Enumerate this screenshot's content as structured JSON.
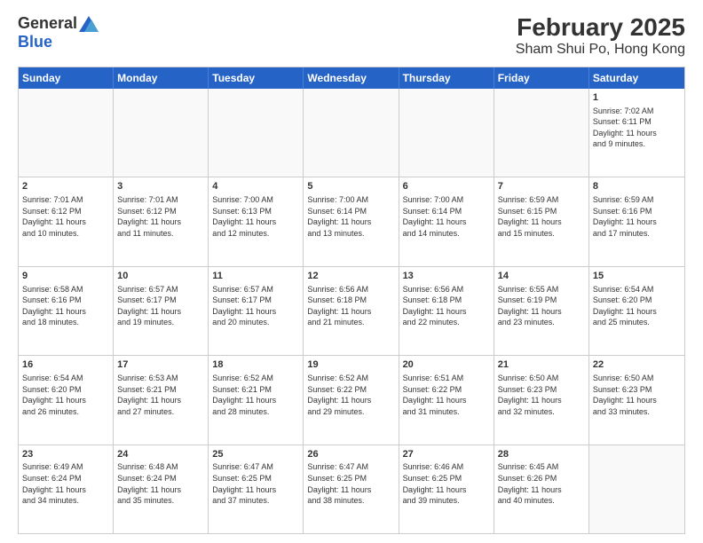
{
  "logo": {
    "general": "General",
    "blue": "Blue"
  },
  "title": {
    "month": "February 2025",
    "location": "Sham Shui Po, Hong Kong"
  },
  "weekdays": [
    "Sunday",
    "Monday",
    "Tuesday",
    "Wednesday",
    "Thursday",
    "Friday",
    "Saturday"
  ],
  "rows": [
    [
      {
        "day": "",
        "info": ""
      },
      {
        "day": "",
        "info": ""
      },
      {
        "day": "",
        "info": ""
      },
      {
        "day": "",
        "info": ""
      },
      {
        "day": "",
        "info": ""
      },
      {
        "day": "",
        "info": ""
      },
      {
        "day": "1",
        "info": "Sunrise: 7:02 AM\nSunset: 6:11 PM\nDaylight: 11 hours\nand 9 minutes."
      }
    ],
    [
      {
        "day": "2",
        "info": "Sunrise: 7:01 AM\nSunset: 6:12 PM\nDaylight: 11 hours\nand 10 minutes."
      },
      {
        "day": "3",
        "info": "Sunrise: 7:01 AM\nSunset: 6:12 PM\nDaylight: 11 hours\nand 11 minutes."
      },
      {
        "day": "4",
        "info": "Sunrise: 7:00 AM\nSunset: 6:13 PM\nDaylight: 11 hours\nand 12 minutes."
      },
      {
        "day": "5",
        "info": "Sunrise: 7:00 AM\nSunset: 6:14 PM\nDaylight: 11 hours\nand 13 minutes."
      },
      {
        "day": "6",
        "info": "Sunrise: 7:00 AM\nSunset: 6:14 PM\nDaylight: 11 hours\nand 14 minutes."
      },
      {
        "day": "7",
        "info": "Sunrise: 6:59 AM\nSunset: 6:15 PM\nDaylight: 11 hours\nand 15 minutes."
      },
      {
        "day": "8",
        "info": "Sunrise: 6:59 AM\nSunset: 6:16 PM\nDaylight: 11 hours\nand 17 minutes."
      }
    ],
    [
      {
        "day": "9",
        "info": "Sunrise: 6:58 AM\nSunset: 6:16 PM\nDaylight: 11 hours\nand 18 minutes."
      },
      {
        "day": "10",
        "info": "Sunrise: 6:57 AM\nSunset: 6:17 PM\nDaylight: 11 hours\nand 19 minutes."
      },
      {
        "day": "11",
        "info": "Sunrise: 6:57 AM\nSunset: 6:17 PM\nDaylight: 11 hours\nand 20 minutes."
      },
      {
        "day": "12",
        "info": "Sunrise: 6:56 AM\nSunset: 6:18 PM\nDaylight: 11 hours\nand 21 minutes."
      },
      {
        "day": "13",
        "info": "Sunrise: 6:56 AM\nSunset: 6:18 PM\nDaylight: 11 hours\nand 22 minutes."
      },
      {
        "day": "14",
        "info": "Sunrise: 6:55 AM\nSunset: 6:19 PM\nDaylight: 11 hours\nand 23 minutes."
      },
      {
        "day": "15",
        "info": "Sunrise: 6:54 AM\nSunset: 6:20 PM\nDaylight: 11 hours\nand 25 minutes."
      }
    ],
    [
      {
        "day": "16",
        "info": "Sunrise: 6:54 AM\nSunset: 6:20 PM\nDaylight: 11 hours\nand 26 minutes."
      },
      {
        "day": "17",
        "info": "Sunrise: 6:53 AM\nSunset: 6:21 PM\nDaylight: 11 hours\nand 27 minutes."
      },
      {
        "day": "18",
        "info": "Sunrise: 6:52 AM\nSunset: 6:21 PM\nDaylight: 11 hours\nand 28 minutes."
      },
      {
        "day": "19",
        "info": "Sunrise: 6:52 AM\nSunset: 6:22 PM\nDaylight: 11 hours\nand 29 minutes."
      },
      {
        "day": "20",
        "info": "Sunrise: 6:51 AM\nSunset: 6:22 PM\nDaylight: 11 hours\nand 31 minutes."
      },
      {
        "day": "21",
        "info": "Sunrise: 6:50 AM\nSunset: 6:23 PM\nDaylight: 11 hours\nand 32 minutes."
      },
      {
        "day": "22",
        "info": "Sunrise: 6:50 AM\nSunset: 6:23 PM\nDaylight: 11 hours\nand 33 minutes."
      }
    ],
    [
      {
        "day": "23",
        "info": "Sunrise: 6:49 AM\nSunset: 6:24 PM\nDaylight: 11 hours\nand 34 minutes."
      },
      {
        "day": "24",
        "info": "Sunrise: 6:48 AM\nSunset: 6:24 PM\nDaylight: 11 hours\nand 35 minutes."
      },
      {
        "day": "25",
        "info": "Sunrise: 6:47 AM\nSunset: 6:25 PM\nDaylight: 11 hours\nand 37 minutes."
      },
      {
        "day": "26",
        "info": "Sunrise: 6:47 AM\nSunset: 6:25 PM\nDaylight: 11 hours\nand 38 minutes."
      },
      {
        "day": "27",
        "info": "Sunrise: 6:46 AM\nSunset: 6:25 PM\nDaylight: 11 hours\nand 39 minutes."
      },
      {
        "day": "28",
        "info": "Sunrise: 6:45 AM\nSunset: 6:26 PM\nDaylight: 11 hours\nand 40 minutes."
      },
      {
        "day": "",
        "info": ""
      }
    ]
  ]
}
